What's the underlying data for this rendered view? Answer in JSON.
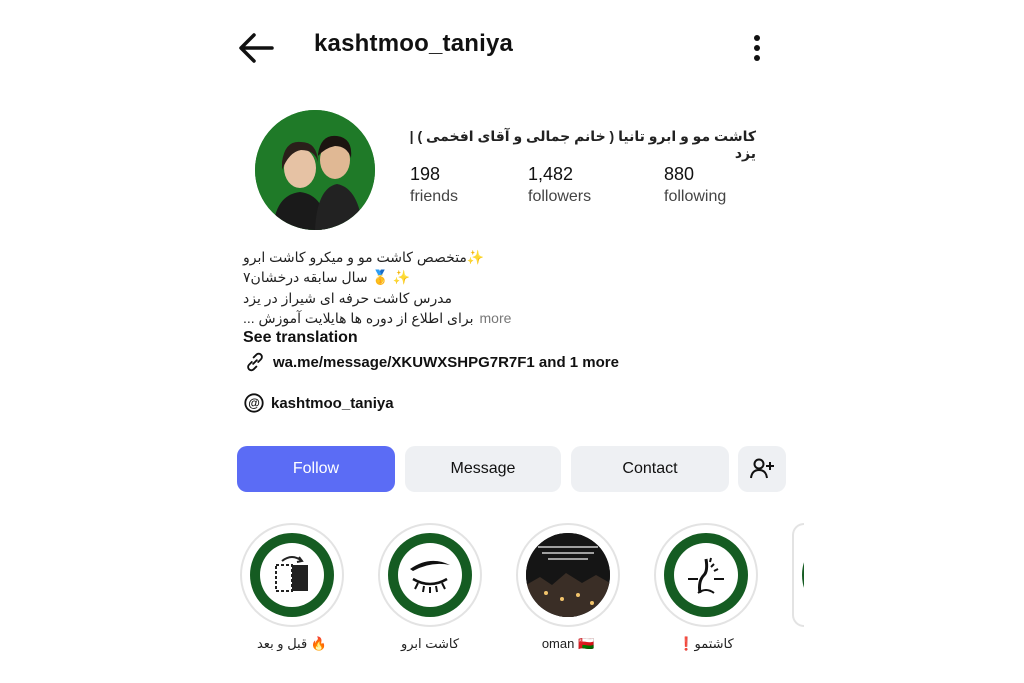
{
  "header": {
    "username": "kashtmoo_taniya"
  },
  "profile": {
    "display_name": "کاشت مو و ابرو تانیا ( خانم جمالی و آقای افخمی ) | یزد",
    "stats": [
      {
        "value": "198",
        "label": "friends"
      },
      {
        "value": "1,482",
        "label": "followers"
      },
      {
        "value": "880",
        "label": "following"
      }
    ],
    "bio": {
      "line1": "✨متخصص کاشت مو و میکرو کاشت ابرو",
      "line2": "✨ 🥇 سال سابقه درخشان۷",
      "line3": "مدرس کاشت حرفه ای شیراز در یزد",
      "line4": "برای اطلاع از دوره ها هایلایت آموزش ...",
      "more": "more"
    },
    "see_translation": "See translation",
    "link": "wa.me/message/XKUWXSHPG7R7F1 and 1 more",
    "threads": "kashtmoo_taniya"
  },
  "actions": {
    "follow": "Follow",
    "message": "Message",
    "contact": "Contact"
  },
  "highlights": [
    {
      "label": "قبل و بعد 🔥",
      "icon": "before-after-icon"
    },
    {
      "label": "کاشت ابرو",
      "icon": "eyebrow-icon"
    },
    {
      "label": "oman 🇴🇲",
      "icon": "photo-thumbnail"
    },
    {
      "label": "❗کاشتمو",
      "icon": "hair-follicle-icon"
    }
  ],
  "colors": {
    "follow": "#5b6cf5",
    "highlight_ring": "#155c22"
  }
}
